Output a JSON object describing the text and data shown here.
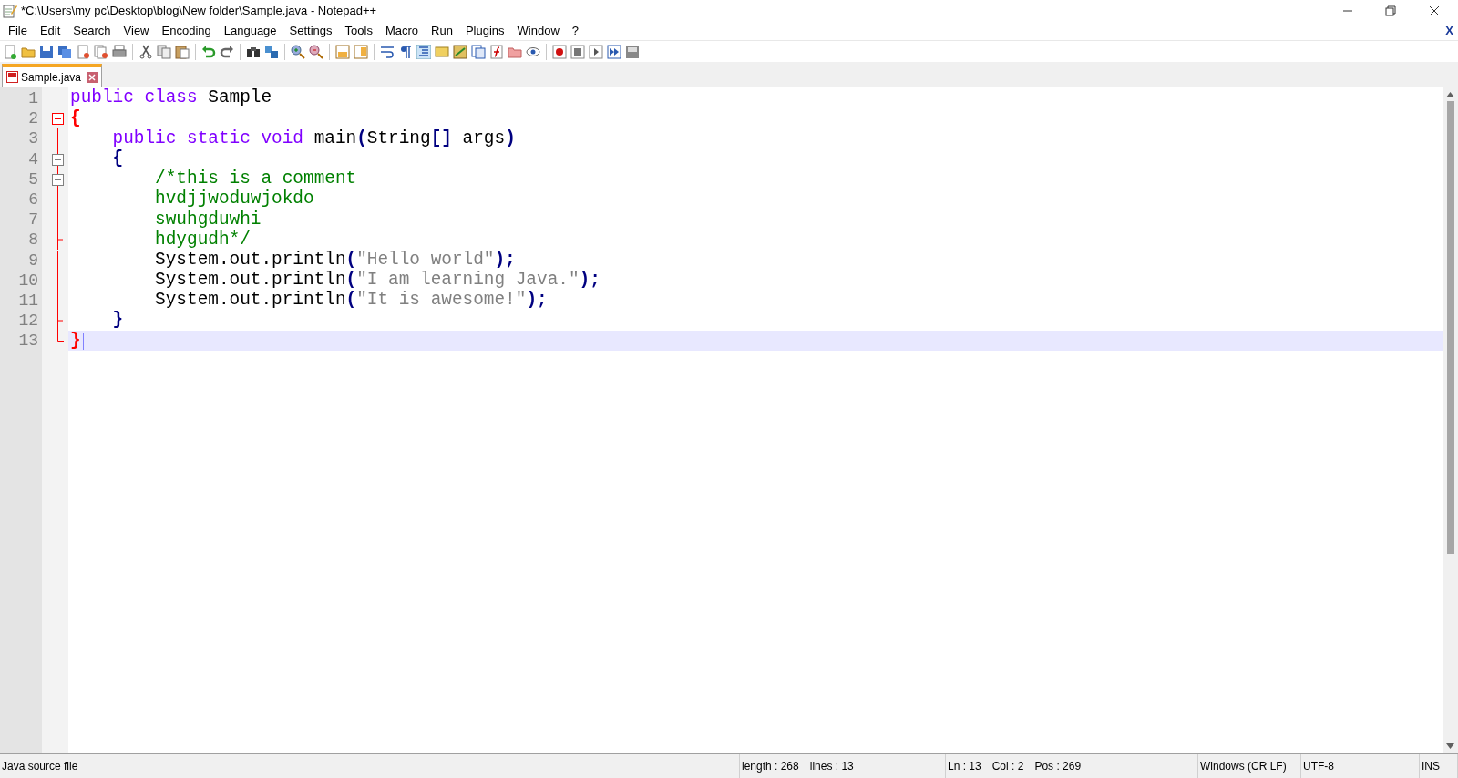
{
  "window": {
    "title": "*C:\\Users\\my pc\\Desktop\\blog\\New folder\\Sample.java - Notepad++"
  },
  "menu": [
    "File",
    "Edit",
    "Search",
    "View",
    "Encoding",
    "Language",
    "Settings",
    "Tools",
    "Macro",
    "Run",
    "Plugins",
    "Window",
    "?"
  ],
  "menu_close": "X",
  "tabs": [
    {
      "label": "Sample.java",
      "selected": true
    }
  ],
  "editor": {
    "lines": [
      {
        "number": "1",
        "kind": "plain",
        "selected": false,
        "tokens": [
          {
            "kind": "keyword",
            "text": "public class"
          },
          {
            "kind": "plain",
            "text": " Sample"
          }
        ]
      },
      {
        "number": "2",
        "kind": "branch",
        "selected": false,
        "tokens": [
          {
            "kind": "brace-red",
            "text": "{"
          }
        ]
      },
      {
        "number": "3",
        "kind": "body",
        "selected": false,
        "tokens": [
          {
            "kind": "keyword",
            "text": "    public static void"
          },
          {
            "kind": "plain",
            "text": " main"
          },
          {
            "kind": "operator",
            "text": "("
          },
          {
            "kind": "plain",
            "text": "String"
          },
          {
            "kind": "operator",
            "text": "[]"
          },
          {
            "kind": "plain",
            "text": " args"
          },
          {
            "kind": "operator",
            "text": ")"
          }
        ]
      },
      {
        "number": "4",
        "kind": "open",
        "selected": false,
        "tokens": [
          {
            "kind": "operator",
            "text": "    {"
          }
        ]
      },
      {
        "number": "5",
        "kind": "open",
        "selected": false,
        "tokens": [
          {
            "kind": "comment",
            "text": "        /*this is a comment"
          }
        ]
      },
      {
        "number": "6",
        "kind": "body",
        "selected": false,
        "tokens": [
          {
            "kind": "comment",
            "text": "        hvdjjwoduwjokdo"
          }
        ]
      },
      {
        "number": "7",
        "kind": "body",
        "selected": false,
        "tokens": [
          {
            "kind": "comment",
            "text": "        swuhgduwhi"
          }
        ]
      },
      {
        "number": "8",
        "kind": "tick",
        "selected": false,
        "tokens": [
          {
            "kind": "comment",
            "text": "        hdygudh*/"
          }
        ]
      },
      {
        "number": "9",
        "kind": "body",
        "selected": false,
        "tokens": [
          {
            "kind": "plain",
            "text": "        System.out.println"
          },
          {
            "kind": "operator",
            "text": "("
          },
          {
            "kind": "string",
            "text": "\"Hello world\""
          },
          {
            "kind": "operator",
            "text": ");"
          }
        ]
      },
      {
        "number": "10",
        "kind": "body",
        "selected": false,
        "tokens": [
          {
            "kind": "plain",
            "text": "        System.out.println"
          },
          {
            "kind": "operator",
            "text": "("
          },
          {
            "kind": "string",
            "text": "\"I am learning Java.\""
          },
          {
            "kind": "operator",
            "text": ");"
          }
        ]
      },
      {
        "number": "11",
        "kind": "body",
        "selected": false,
        "tokens": [
          {
            "kind": "plain",
            "text": "        System.out.println"
          },
          {
            "kind": "operator",
            "text": "("
          },
          {
            "kind": "string",
            "text": "\"It is awesome!\""
          },
          {
            "kind": "operator",
            "text": ");"
          }
        ]
      },
      {
        "number": "12",
        "kind": "tick",
        "selected": false,
        "tokens": [
          {
            "kind": "operator",
            "text": "    }"
          }
        ]
      },
      {
        "number": "13",
        "kind": "end",
        "selected": true,
        "tokens": [
          {
            "kind": "brace-red",
            "text": "}"
          }
        ]
      }
    ]
  },
  "status_bar": [
    {
      "texts": [
        "Java source file"
      ]
    },
    {
      "texts": [
        "length : 268",
        "lines : 13"
      ]
    },
    {
      "texts": [
        "Ln : 13",
        "Col : 2",
        "Pos : 269"
      ]
    },
    {
      "texts": [
        "Windows (CR LF)"
      ]
    },
    {
      "texts": [
        "UTF-8"
      ]
    },
    {
      "texts": [
        "INS"
      ]
    }
  ]
}
